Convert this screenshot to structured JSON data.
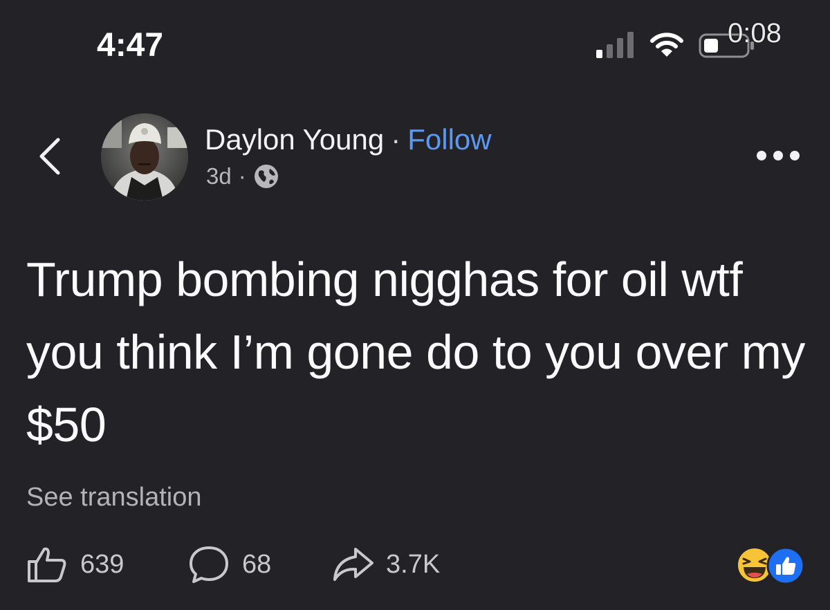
{
  "status_bar": {
    "time": "4:47",
    "recording_time": "0:08",
    "icons": [
      "cellular-signal-icon",
      "wifi-icon",
      "battery-icon"
    ]
  },
  "post": {
    "author": "Daylon Young",
    "separator": "·",
    "follow_label": "Follow",
    "age": "3d",
    "meta_separator": "·",
    "audience_icon": "globe-icon",
    "text": "Trump bombing nigghas for oil wtf you think I’m gone do to you over my $50",
    "see_translation": "See translation"
  },
  "actions": {
    "likes": "639",
    "comments": "68",
    "shares": "3.7K"
  },
  "reactions": [
    "haha-emoji",
    "like-reaction"
  ],
  "colors": {
    "background": "#232226",
    "link": "#5a9af5",
    "like_blue": "#1e6ff2",
    "haha_yellow": "#f7c437"
  }
}
